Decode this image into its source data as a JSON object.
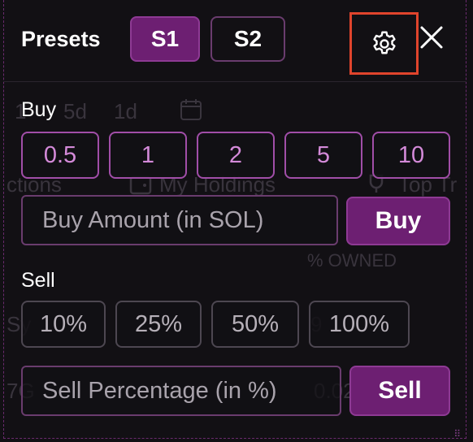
{
  "header": {
    "title": "Presets",
    "presets": [
      {
        "label": "S1",
        "active": true
      },
      {
        "label": "S2",
        "active": false
      }
    ],
    "settings_icon": "gear-icon",
    "close_icon": "close-icon"
  },
  "buy": {
    "label": "Buy",
    "amounts": [
      "0.5",
      "1",
      "2",
      "5",
      "10"
    ],
    "input_placeholder": "Buy Amount (in SOL)",
    "button_label": "Buy"
  },
  "sell": {
    "label": "Sell",
    "percentages": [
      "10%",
      "25%",
      "50%",
      "100%"
    ],
    "input_placeholder": "Sell Percentage (in %)",
    "button_label": "Sell"
  },
  "background": {
    "timeframes": [
      "1",
      "5d",
      "1d"
    ],
    "tabs": [
      "ctions",
      "My Holdings",
      "Top Tr"
    ],
    "column": "% OWNED",
    "row": [
      "Sy",
      "9",
      "7G",
      "0.02"
    ]
  },
  "colors": {
    "accent": "#6d1f72",
    "accent_text": "#d48ad9",
    "highlight": "#e0442c"
  }
}
